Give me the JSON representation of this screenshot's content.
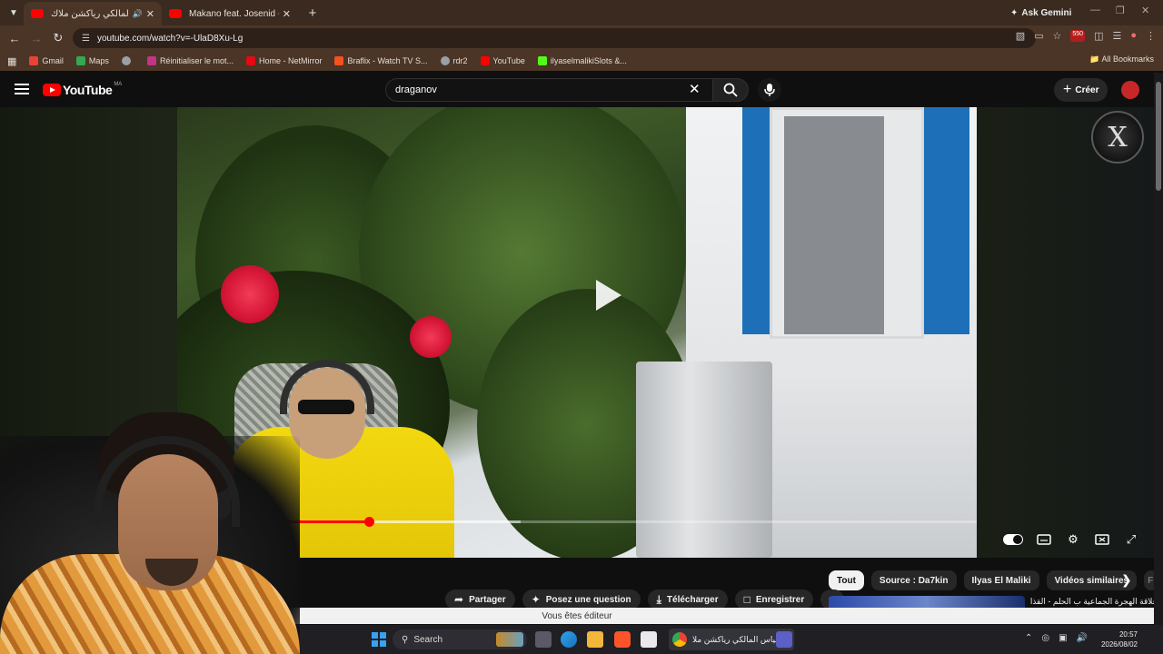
{
  "browser": {
    "tabs": [
      {
        "title": "الياس المالكي رياكشن ملاك",
        "active": true
      },
      {
        "title": "Makano feat. Josenid - Su Nom",
        "active": false
      }
    ],
    "ask_gemini": "Ask Gemini",
    "url": "youtube.com/watch?v=-UlaD8Xu-Lg",
    "ext_badge": "550",
    "bookmarks": [
      {
        "label": "Gmail",
        "color": "#ea4335"
      },
      {
        "label": "Maps",
        "color": "#34a853"
      },
      {
        "label": "",
        "color": "#9aa0a6"
      },
      {
        "label": "Réinitialiser le mot...",
        "color": "#c13584"
      },
      {
        "label": "Home - NetMirror",
        "color": "#e50914"
      },
      {
        "label": "Braflix - Watch TV S...",
        "color": "#f4511e"
      },
      {
        "label": "rdr2",
        "color": "#9aa0a6"
      },
      {
        "label": "YouTube",
        "color": "#ff0000"
      },
      {
        "label": "ilyaselmalikiSlots &...",
        "color": "#53fc18"
      }
    ],
    "all_bookmarks": "All Bookmarks"
  },
  "youtube": {
    "logo_text": "YouTube",
    "country_code": "MA",
    "search_value": "draganov",
    "create_label": "Créer",
    "channel_logo_glyph": "X"
  },
  "player": {
    "progress_fraction": 0.24,
    "loaded_fraction": 0.43
  },
  "chips": [
    "Tout",
    "Source : Da7kin",
    "Ilyas El Maliki",
    "Vidéos similaires",
    "F"
  ],
  "actions": [
    {
      "label": "Partager",
      "icon": "share-icon"
    },
    {
      "label": "Posez une question",
      "icon": "sparkle-icon"
    },
    {
      "label": "Télécharger",
      "icon": "download-icon"
    },
    {
      "label": "Enregistrer",
      "icon": "bookmark-icon"
    }
  ],
  "related_title": "علاقة الهجرة الجماعية ب الحلم - القذان",
  "editor_banner": "Vous êtes éditeur",
  "taskbar": {
    "search_label": "Search",
    "chrome_window_title": "الياس المالكي رياكشن ملا",
    "time": "20:57",
    "date": "2026/08/02"
  }
}
